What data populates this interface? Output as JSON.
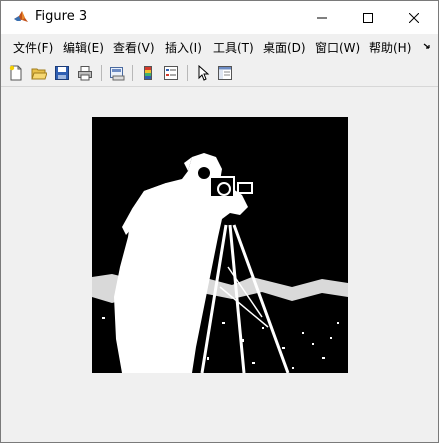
{
  "window": {
    "title": "Figure 3",
    "icon": "matlab-icon"
  },
  "menu": {
    "items": [
      {
        "label": "文件(F)"
      },
      {
        "label": "编辑(E)"
      },
      {
        "label": "查看(V)"
      },
      {
        "label": "插入(I)"
      },
      {
        "label": "工具(T)"
      },
      {
        "label": "桌面(D)"
      },
      {
        "label": "窗口(W)"
      },
      {
        "label": "帮助(H)"
      }
    ],
    "overflow_icon": "chevron-more-icon"
  },
  "toolbar": {
    "buttons": [
      {
        "icon": "new-figure-icon"
      },
      {
        "icon": "open-file-icon"
      },
      {
        "icon": "save-figure-icon"
      },
      {
        "icon": "print-figure-icon"
      },
      {
        "icon": "link-plot-icon"
      },
      {
        "icon": "insert-colorbar-icon"
      },
      {
        "icon": "insert-legend-icon"
      },
      {
        "icon": "edit-plot-icon"
      },
      {
        "icon": "property-editor-icon"
      }
    ]
  },
  "figure": {
    "content": "binary-threshold-image",
    "colors": {
      "background": "#000000",
      "foreground": "#ffffff"
    }
  }
}
